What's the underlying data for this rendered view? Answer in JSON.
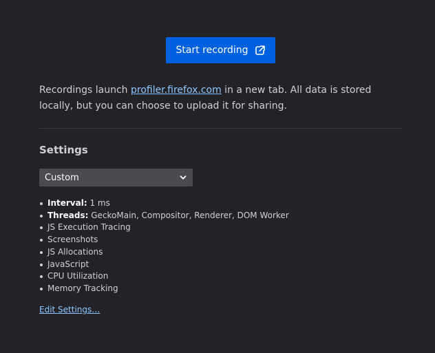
{
  "start_button": {
    "label": "Start recording",
    "icon": "external-link-icon"
  },
  "intro": {
    "before_link": "Recordings launch ",
    "link_text": "profiler.firefox.com",
    "after_link": " in a new tab. All data is stored locally, but you can choose to upload it for sharing."
  },
  "settings": {
    "title": "Settings",
    "preset": {
      "selected": "Custom",
      "icon": "chevron-down-icon"
    },
    "details": [
      {
        "label": "Interval:",
        "value": " 1 ms"
      },
      {
        "label": "Threads:",
        "value": " GeckoMain, Compositor, Renderer, DOM Worker"
      }
    ],
    "features": [
      "JS Execution Tracing",
      "Screenshots",
      "JS Allocations",
      "JavaScript",
      "CPU Utilization",
      "Memory Tracking"
    ],
    "edit_link": "Edit Settings…"
  },
  "colors": {
    "background": "#232327",
    "button": "#0061e0",
    "link": "#8cc8ff",
    "select": "#4a4a50"
  }
}
